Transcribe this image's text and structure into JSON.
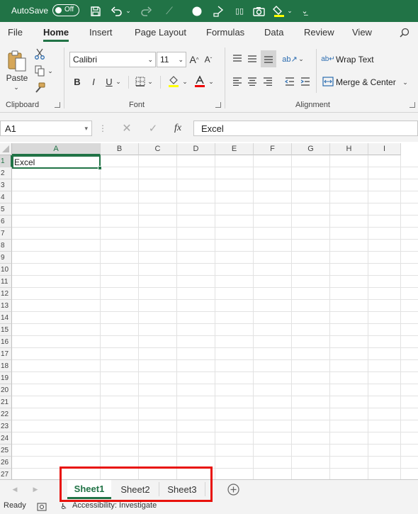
{
  "titlebar": {
    "autosave_label": "AutoSave",
    "autosave_state": "Off",
    "icons": [
      "save-icon",
      "undo-icon",
      "redo-icon",
      "format-painter-icon",
      "circle-icon",
      "touch-mode-icon",
      "form-icon",
      "camera-icon",
      "highlight-icon",
      "customize-icon"
    ]
  },
  "ribbon_tabs": [
    "File",
    "Home",
    "Insert",
    "Page Layout",
    "Formulas",
    "Data",
    "Review",
    "View"
  ],
  "ribbon": {
    "clipboard": {
      "label": "Clipboard",
      "paste_label": "Paste"
    },
    "font": {
      "label": "Font",
      "font_name": "Calibri",
      "font_size": "11",
      "bold": "B",
      "italic": "I",
      "underline": "U"
    },
    "alignment": {
      "label": "Alignment",
      "wrap_text": "Wrap Text",
      "merge_center": "Merge & Center"
    }
  },
  "formula_bar": {
    "name_box": "A1",
    "fx": "fx",
    "content": "Excel"
  },
  "sheet": {
    "columns": [
      "A",
      "B",
      "C",
      "D",
      "E",
      "F",
      "G",
      "H",
      "I"
    ],
    "rows": [
      "1",
      "2",
      "3",
      "4",
      "5",
      "6",
      "7",
      "8",
      "9",
      "10",
      "11",
      "12",
      "13",
      "14",
      "15",
      "16",
      "17",
      "18",
      "19",
      "20",
      "21",
      "22",
      "23",
      "24",
      "25",
      "26",
      "27"
    ],
    "cell_a1": "Excel"
  },
  "sheet_tabs": {
    "tabs": [
      "Sheet1",
      "Sheet2",
      "Sheet3"
    ],
    "active": "Sheet1"
  },
  "status": {
    "ready": "Ready",
    "accessibility": "Accessibility: Investigate"
  },
  "colors": {
    "accent": "#217346",
    "highlight_box": "#e8120c"
  }
}
